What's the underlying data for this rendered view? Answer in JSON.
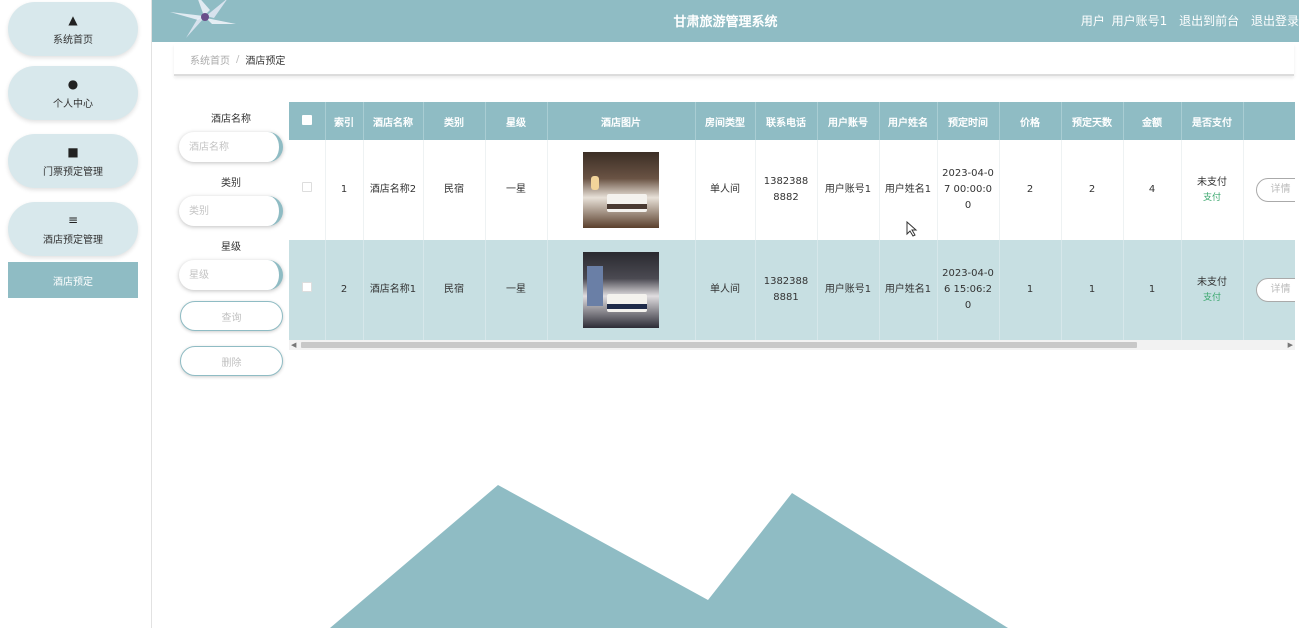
{
  "header": {
    "title": "甘肃旅游管理系统",
    "user_role": "用户",
    "user_account": "用户账号1",
    "back_front": "退出到前台",
    "logout": "退出登录"
  },
  "sidebar": {
    "items": [
      {
        "label": "系统首页",
        "icon": "home-icon"
      },
      {
        "label": "个人中心",
        "icon": "user-icon"
      },
      {
        "label": "门票预定管理",
        "icon": "ticket-icon"
      },
      {
        "label": "酒店预定管理",
        "icon": "sliders-icon"
      }
    ],
    "sub_item": "酒店预定"
  },
  "breadcrumb": {
    "home": "系统首页",
    "separator": "/",
    "current": "酒店预定"
  },
  "search": {
    "hotel_name_label": "酒店名称",
    "hotel_name_placeholder": "酒店名称",
    "category_label": "类别",
    "category_placeholder": "类别",
    "star_label": "星级",
    "star_placeholder": "星级",
    "query_button": "查询",
    "delete_button": "删除"
  },
  "table": {
    "columns": [
      "索引",
      "酒店名称",
      "类别",
      "星级",
      "酒店图片",
      "房间类型",
      "联系电话",
      "用户账号",
      "用户姓名",
      "预定时间",
      "价格",
      "预定天数",
      "金额",
      "是否支付"
    ],
    "rows": [
      {
        "index": "1",
        "hotel_name": "酒店名称2",
        "category": "民宿",
        "star": "一星",
        "room_type": "单人间",
        "phone": "13823888882",
        "user_account": "用户账号1",
        "user_name": "用户姓名1",
        "book_time": "2023-04-07 00:00:00",
        "price": "2",
        "days": "2",
        "amount": "4",
        "pay_status": "未支付",
        "pay_link": "支付",
        "detail": "详情"
      },
      {
        "index": "2",
        "hotel_name": "酒店名称1",
        "category": "民宿",
        "star": "一星",
        "room_type": "单人间",
        "phone": "13823888881",
        "user_account": "用户账号1",
        "user_name": "用户姓名1",
        "book_time": "2023-04-06 15:06:20",
        "price": "1",
        "days": "1",
        "amount": "1",
        "pay_status": "未支付",
        "pay_link": "支付",
        "detail": "详情"
      }
    ]
  },
  "colors": {
    "accent": "#8fbcc4",
    "row_highlight": "#c7dfe2",
    "pay_link": "#3aa76d"
  }
}
